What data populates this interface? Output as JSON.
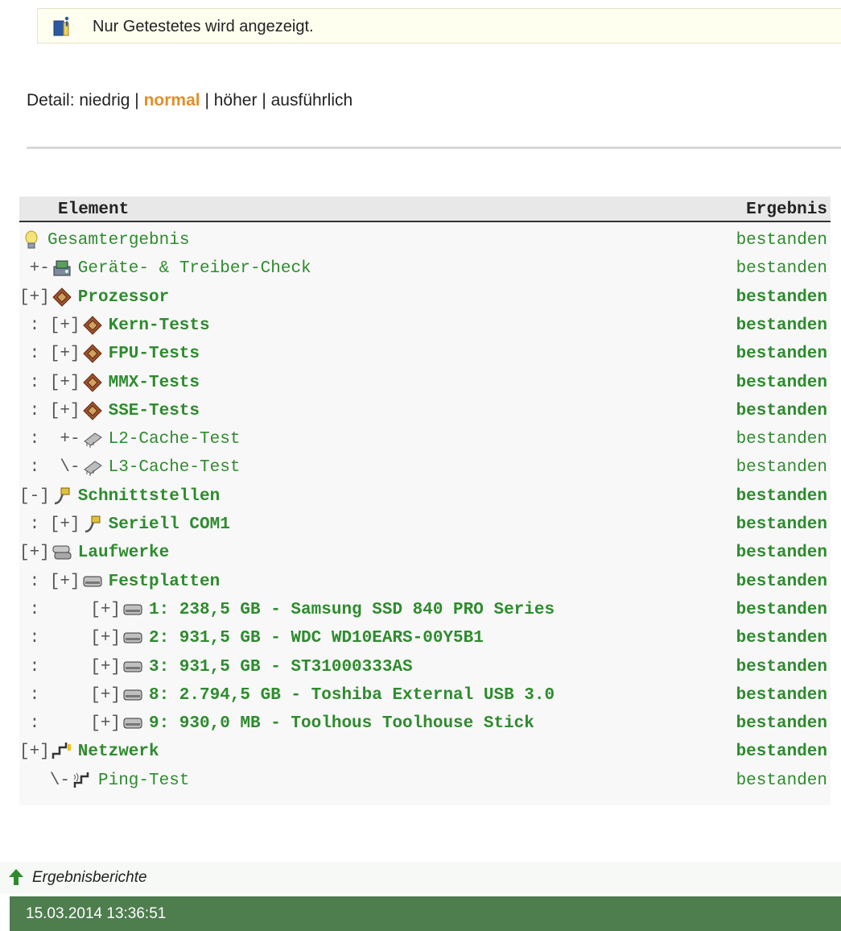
{
  "notice": {
    "text": "Nur Getestetes wird angezeigt.",
    "icon": "info-book-icon"
  },
  "detail": {
    "label": "Detail:",
    "separator": "|",
    "options": [
      "niedrig",
      "normal",
      "höher",
      "ausführlich"
    ],
    "active": "normal",
    "active_color": "#e0902a"
  },
  "table": {
    "headers": {
      "element": "Element",
      "result": "Ergebnis"
    },
    "result_color": "#2e8b2e",
    "rows": [
      {
        "prefix": "",
        "icon": "lightbulb-icon",
        "label": "Gesamtergebnis",
        "result": "bestanden",
        "bold": false
      },
      {
        "prefix": " +-",
        "icon": "devices-icon",
        "label": "Geräte- & Treiber-Check",
        "result": "bestanden",
        "bold": false
      },
      {
        "prefix": "[+]",
        "icon": "processor-icon",
        "label": "Prozessor",
        "result": "bestanden",
        "bold": true
      },
      {
        "prefix": " : [+]",
        "icon": "processor-icon",
        "label": "Kern-Tests",
        "result": "bestanden",
        "bold": true
      },
      {
        "prefix": " : [+]",
        "icon": "processor-icon",
        "label": "FPU-Tests",
        "result": "bestanden",
        "bold": true
      },
      {
        "prefix": " : [+]",
        "icon": "processor-icon",
        "label": "MMX-Tests",
        "result": "bestanden",
        "bold": true
      },
      {
        "prefix": " : [+]",
        "icon": "processor-icon",
        "label": "SSE-Tests",
        "result": "bestanden",
        "bold": true
      },
      {
        "prefix": " :  +-",
        "icon": "memory-chip-icon",
        "label": "L2-Cache-Test",
        "result": "bestanden",
        "bold": false
      },
      {
        "prefix": " :  \\-",
        "icon": "memory-chip-icon",
        "label": "L3-Cache-Test",
        "result": "bestanden",
        "bold": false
      },
      {
        "prefix": "[-]",
        "icon": "serial-cable-icon",
        "label": "Schnittstellen",
        "result": "bestanden",
        "bold": true
      },
      {
        "prefix": " : [+]",
        "icon": "serial-cable-icon",
        "label": "Seriell COM1",
        "result": "bestanden",
        "bold": true
      },
      {
        "prefix": "[+]",
        "icon": "drives-icon",
        "label": "Laufwerke",
        "result": "bestanden",
        "bold": true
      },
      {
        "prefix": " : [+]",
        "icon": "hard-disk-icon",
        "label": "Festplatten",
        "result": "bestanden",
        "bold": true
      },
      {
        "prefix": " :     [+]",
        "icon": "hard-disk-icon",
        "label": "1: 238,5 GB - Samsung SSD 840 PRO Series",
        "result": "bestanden",
        "bold": true
      },
      {
        "prefix": " :     [+]",
        "icon": "hard-disk-icon",
        "label": "2: 931,5 GB - WDC WD10EARS-00Y5B1",
        "result": "bestanden",
        "bold": true
      },
      {
        "prefix": " :     [+]",
        "icon": "hard-disk-icon",
        "label": "3: 931,5 GB - ST31000333AS",
        "result": "bestanden",
        "bold": true
      },
      {
        "prefix": " :     [+]",
        "icon": "hard-disk-icon",
        "label": "8: 2.794,5 GB - Toshiba External USB 3.0",
        "result": "bestanden",
        "bold": true
      },
      {
        "prefix": " :     [+]",
        "icon": "hard-disk-icon",
        "label": "9: 930,0 MB - Toolhous Toolhouse Stick",
        "result": "bestanden",
        "bold": true
      },
      {
        "prefix": "[+]",
        "icon": "network-icon",
        "label": "Netzwerk",
        "result": "bestanden",
        "bold": true
      },
      {
        "prefix": "   \\-",
        "icon": "ping-icon",
        "label": "Ping-Test",
        "result": "bestanden",
        "bold": false
      }
    ]
  },
  "reports": {
    "label": "Ergebnisberichte",
    "icon": "arrow-up-icon"
  },
  "footer": {
    "timestamp": "15.03.2014 13:36:51",
    "color": "#4e7d4e"
  }
}
